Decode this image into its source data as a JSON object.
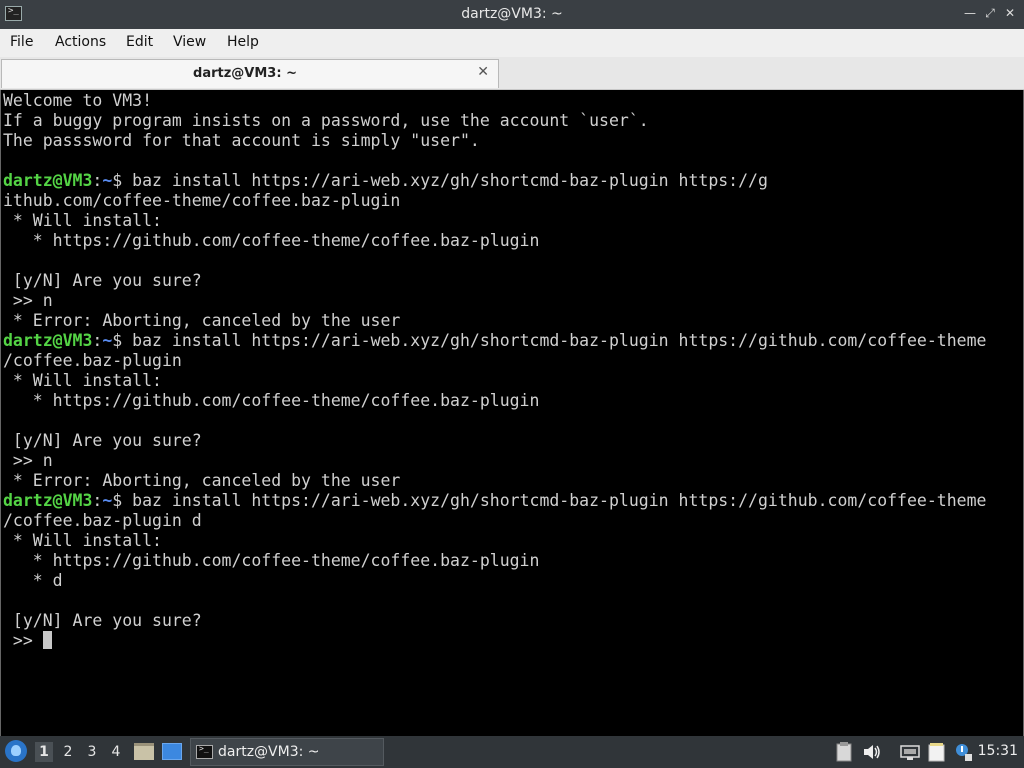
{
  "window": {
    "title": "dartz@VM3: ~",
    "icon": "terminal-icon",
    "controls": {
      "minimize": "minimize-icon",
      "restore": "restore-icon",
      "close": "close-icon"
    }
  },
  "menu": {
    "items": [
      "File",
      "Actions",
      "Edit",
      "View",
      "Help"
    ]
  },
  "tabs": [
    {
      "label": "dartz@VM3: ~",
      "close_icon": "close-icon"
    }
  ],
  "terminal": {
    "prompt_user": "dartz@VM3",
    "prompt_colon": ":",
    "prompt_path": "~",
    "prompt_dollar": "$",
    "lines": [
      "Welcome to VM3!",
      "If a buggy program insists on a password, use the account `user`.",
      "The passsword for that account is simply \"user\".",
      "",
      " baz install https://ari-web.xyz/gh/shortcmd-baz-plugin https://g",
      "ithub.com/coffee-theme/coffee.baz-plugin",
      " * Will install:",
      "   * https://github.com/coffee-theme/coffee.baz-plugin",
      "",
      " [y/N] Are you sure?",
      " >> n",
      " * Error: Aborting, canceled by the user",
      " baz install https://ari-web.xyz/gh/shortcmd-baz-plugin https://github.com/coffee-theme",
      "/coffee.baz-plugin",
      " * Will install:",
      "   * https://github.com/coffee-theme/coffee.baz-plugin",
      "",
      " [y/N] Are you sure?",
      " >> n",
      " * Error: Aborting, canceled by the user",
      " baz install https://ari-web.xyz/gh/shortcmd-baz-plugin https://github.com/coffee-theme",
      "/coffee.baz-plugin d",
      " * Will install:",
      "   * https://github.com/coffee-theme/coffee.baz-plugin",
      "   * d",
      "",
      " [y/N] Are you sure?",
      " >> "
    ],
    "prompt_line_indices": [
      4,
      12,
      20
    ],
    "cursor_line_index": 27
  },
  "taskbar": {
    "start_icon": "start-menu-icon",
    "workspaces": [
      "1",
      "2",
      "3",
      "4"
    ],
    "active_workspace": "1",
    "quicklaunch": [
      "file-manager-icon",
      "show-desktop-icon"
    ],
    "task": {
      "label": "dartz@VM3: ~",
      "icon": "terminal-icon"
    },
    "tray": [
      "clipboard-icon",
      "volume-icon",
      "network-icon",
      "notes-icon",
      "update-notifier-icon"
    ],
    "clock": "15:31"
  },
  "colors": {
    "prompt_user": "#54d445",
    "prompt_path": "#5a8df2",
    "terminal_bg": "#000000",
    "terminal_fg": "#d0d0d0",
    "titlebar_bg": "#3a3f44",
    "taskbar_bg": "#303539"
  }
}
